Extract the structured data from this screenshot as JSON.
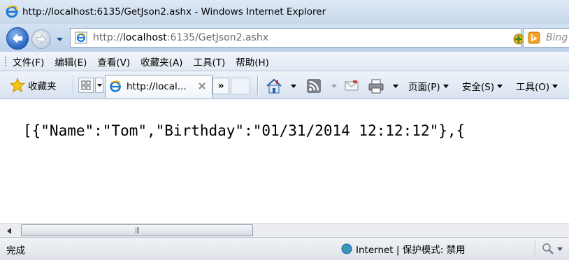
{
  "window": {
    "title": "http://localhost:6135/GetJson2.ashx - Windows Internet Explorer"
  },
  "address_bar": {
    "url_prefix": "http://",
    "url_host": "localhost",
    "url_rest": ":6135/GetJson2.ashx"
  },
  "search": {
    "placeholder": "Bing"
  },
  "menu": {
    "items": [
      "文件(F)",
      "编辑(E)",
      "查看(V)",
      "收藏夹(A)",
      "工具(T)",
      "帮助(H)"
    ]
  },
  "favorites_bar": {
    "favorites_label": "收藏夹",
    "tab_label": "http://local...",
    "more_tabs_label": "»"
  },
  "command_bar": {
    "page_label": "页面(P)",
    "safety_label": "安全(S)",
    "tools_label": "工具(O)"
  },
  "content": {
    "json_text": "[{\"Name\":\"Tom\",\"Birthday\":\"01/31/2014 12:12:12\"},{"
  },
  "status_bar": {
    "status": "完成",
    "zone": "Internet | 保护模式: 禁用"
  },
  "icons": {
    "back": "back-arrow-icon",
    "forward": "forward-arrow-icon",
    "page": "ie-page-icon",
    "favorites": "star-icon",
    "home": "home-icon",
    "feeds": "rss-icon",
    "mail": "mail-icon",
    "print": "printer-icon",
    "zone": "globe-icon"
  },
  "colors": {
    "chrome_blue": "#c7d8ec",
    "back_button": "#2865c4",
    "stop_red": "#d9342b"
  }
}
